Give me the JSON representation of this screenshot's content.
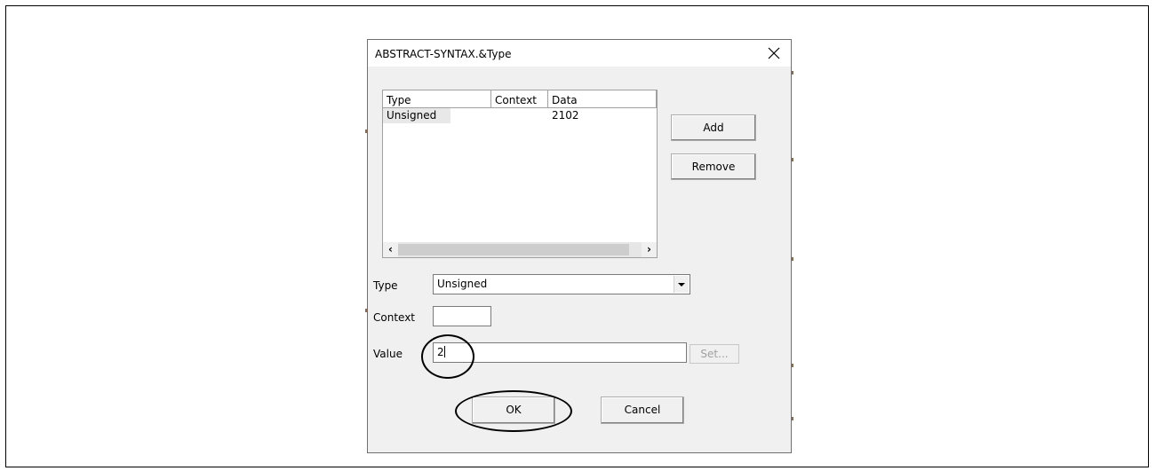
{
  "dialog": {
    "title": "ABSTRACT-SYNTAX.&Type",
    "close_icon": "close-icon",
    "list": {
      "columns": [
        "Type",
        "Context",
        "Data"
      ],
      "rows": [
        {
          "type": "Unsigned",
          "context": "",
          "data": "2102"
        }
      ],
      "scroll_left_icon": "chevron-left-icon",
      "scroll_right_icon": "chevron-right-icon"
    },
    "buttons": {
      "add": "Add",
      "remove": "Remove",
      "set": "Set...",
      "ok": "OK",
      "cancel": "Cancel"
    },
    "form": {
      "type_label": "Type",
      "type_value": "Unsigned",
      "context_label": "Context",
      "context_value": "",
      "value_label": "Value",
      "value_value": "2"
    },
    "annotation_color": "#000000"
  }
}
